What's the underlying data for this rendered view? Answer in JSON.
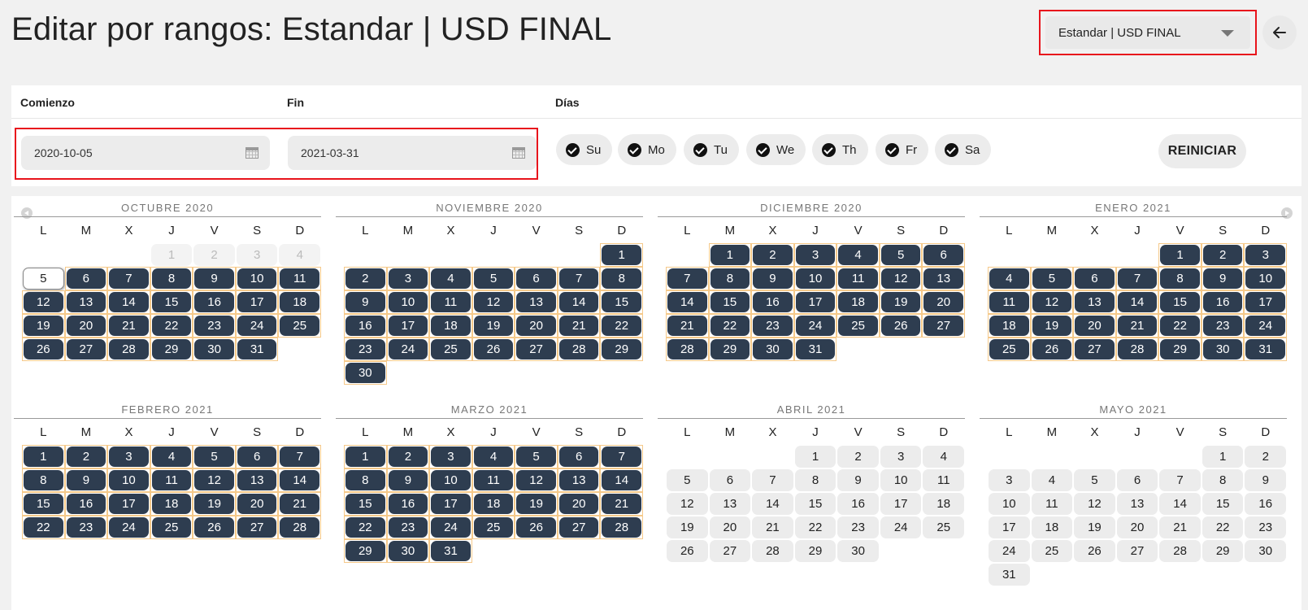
{
  "header": {
    "title": "Editar por rangos: Estandar | USD FINAL",
    "selected_tariff": "Estandar | USD FINAL"
  },
  "filters": {
    "start_label": "Comienzo",
    "end_label": "Fin",
    "days_label": "Días",
    "start_value": "2020-10-05",
    "end_value": "2021-03-31",
    "weekdays": [
      {
        "label": "Su",
        "checked": true
      },
      {
        "label": "Mo",
        "checked": true
      },
      {
        "label": "Tu",
        "checked": true
      },
      {
        "label": "We",
        "checked": true
      },
      {
        "label": "Th",
        "checked": true
      },
      {
        "label": "Fr",
        "checked": true
      },
      {
        "label": "Sa",
        "checked": true
      }
    ],
    "reset_label": "REINICIAR"
  },
  "calendar": {
    "weekday_headers": [
      "L",
      "M",
      "X",
      "J",
      "V",
      "S",
      "D"
    ],
    "colors": {
      "selected": "#2e3d50",
      "selected_border": "#f5c98a",
      "free": "#ececec"
    },
    "months": [
      {
        "title": "OCTUBRE 2020",
        "first_weekday": 3,
        "days": 31,
        "past_until": 4,
        "today": 5,
        "selected_from": 6,
        "selected_to": 31
      },
      {
        "title": "NOVIEMBRE 2020",
        "first_weekday": 6,
        "days": 30,
        "past_until": 0,
        "today": 0,
        "selected_from": 1,
        "selected_to": 30
      },
      {
        "title": "DICIEMBRE 2020",
        "first_weekday": 1,
        "days": 31,
        "past_until": 0,
        "today": 0,
        "selected_from": 1,
        "selected_to": 31
      },
      {
        "title": "ENERO 2021",
        "first_weekday": 4,
        "days": 31,
        "past_until": 0,
        "today": 0,
        "selected_from": 1,
        "selected_to": 31
      },
      {
        "title": "FEBRERO 2021",
        "first_weekday": 0,
        "days": 28,
        "past_until": 0,
        "today": 0,
        "selected_from": 1,
        "selected_to": 28
      },
      {
        "title": "MARZO 2021",
        "first_weekday": 0,
        "days": 31,
        "past_until": 0,
        "today": 0,
        "selected_from": 1,
        "selected_to": 31
      },
      {
        "title": "ABRIL 2021",
        "first_weekday": 3,
        "days": 30,
        "past_until": 0,
        "today": 0,
        "selected_from": 0,
        "selected_to": 0
      },
      {
        "title": "MAYO 2021",
        "first_weekday": 5,
        "days": 31,
        "past_until": 0,
        "today": 0,
        "selected_from": 0,
        "selected_to": 0
      }
    ]
  }
}
